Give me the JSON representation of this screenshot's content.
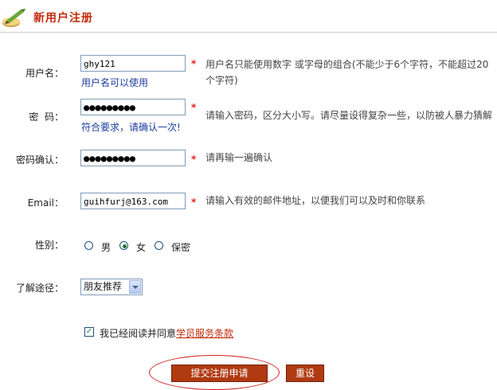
{
  "header": {
    "title": "新用户注册",
    "icon": "pencil-pen-icon"
  },
  "form": {
    "username": {
      "label": "用户名：",
      "value": "ghy121",
      "status": "用户名可以使用",
      "hint_line1": "用户名只能使用数字 或字母的组合(不能少于6个字符，不能超过20",
      "hint_line2": "个字符)"
    },
    "password": {
      "label": "密  码：",
      "value": "●●●●●●●●●",
      "status": "符合要求，请确认一次!",
      "hint": "请输入密码，区分大小写。请尽量设得复杂一些，以防被人暴力猜解"
    },
    "password_confirm": {
      "label": "密码确认：",
      "value": "●●●●●●●●●",
      "hint": "请再输一遍确认"
    },
    "email": {
      "label": "Email：",
      "value": "guihfurj@163.com",
      "hint": "请输入有效的邮件地址，以便我们可以及时和你联系"
    },
    "gender": {
      "label": "性别：",
      "options": [
        "男",
        "女",
        "保密"
      ],
      "selected": "女"
    },
    "source": {
      "label": "了解途径：",
      "selected": "朋友推荐"
    },
    "required_mark": "*",
    "agreement": {
      "text": "我已经阅读并同意",
      "link": "学员服务条款",
      "checked": true
    },
    "submit_label": "提交注册申请",
    "reset_label": "重设"
  }
}
